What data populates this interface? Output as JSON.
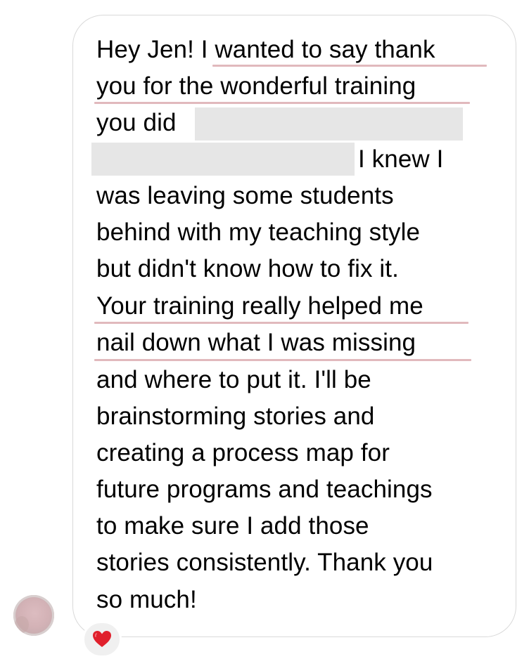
{
  "message": {
    "lines": [
      "Hey Jen! I wanted to say thank",
      "you for the wonderful training",
      "you did",
      "I knew I",
      "was leaving some students",
      "behind with my teaching style",
      "but didn't know how to fix it.",
      "Your training really helped me",
      "nail down what I was missing",
      "and where to put it. I'll be",
      "brainstorming stories and",
      "creating a process map for",
      "future programs and teachings",
      "to make sure I add those",
      "stories consistently. Thank you",
      "so much!"
    ]
  },
  "reaction": {
    "emoji_name": "heart-icon",
    "color": "#e0202c"
  },
  "colors": {
    "bubble_border": "#d9d9d9",
    "highlight_underline": "#e1b9bd",
    "redaction": "#e6e6e6",
    "reaction_bg": "#f0f0f0"
  }
}
